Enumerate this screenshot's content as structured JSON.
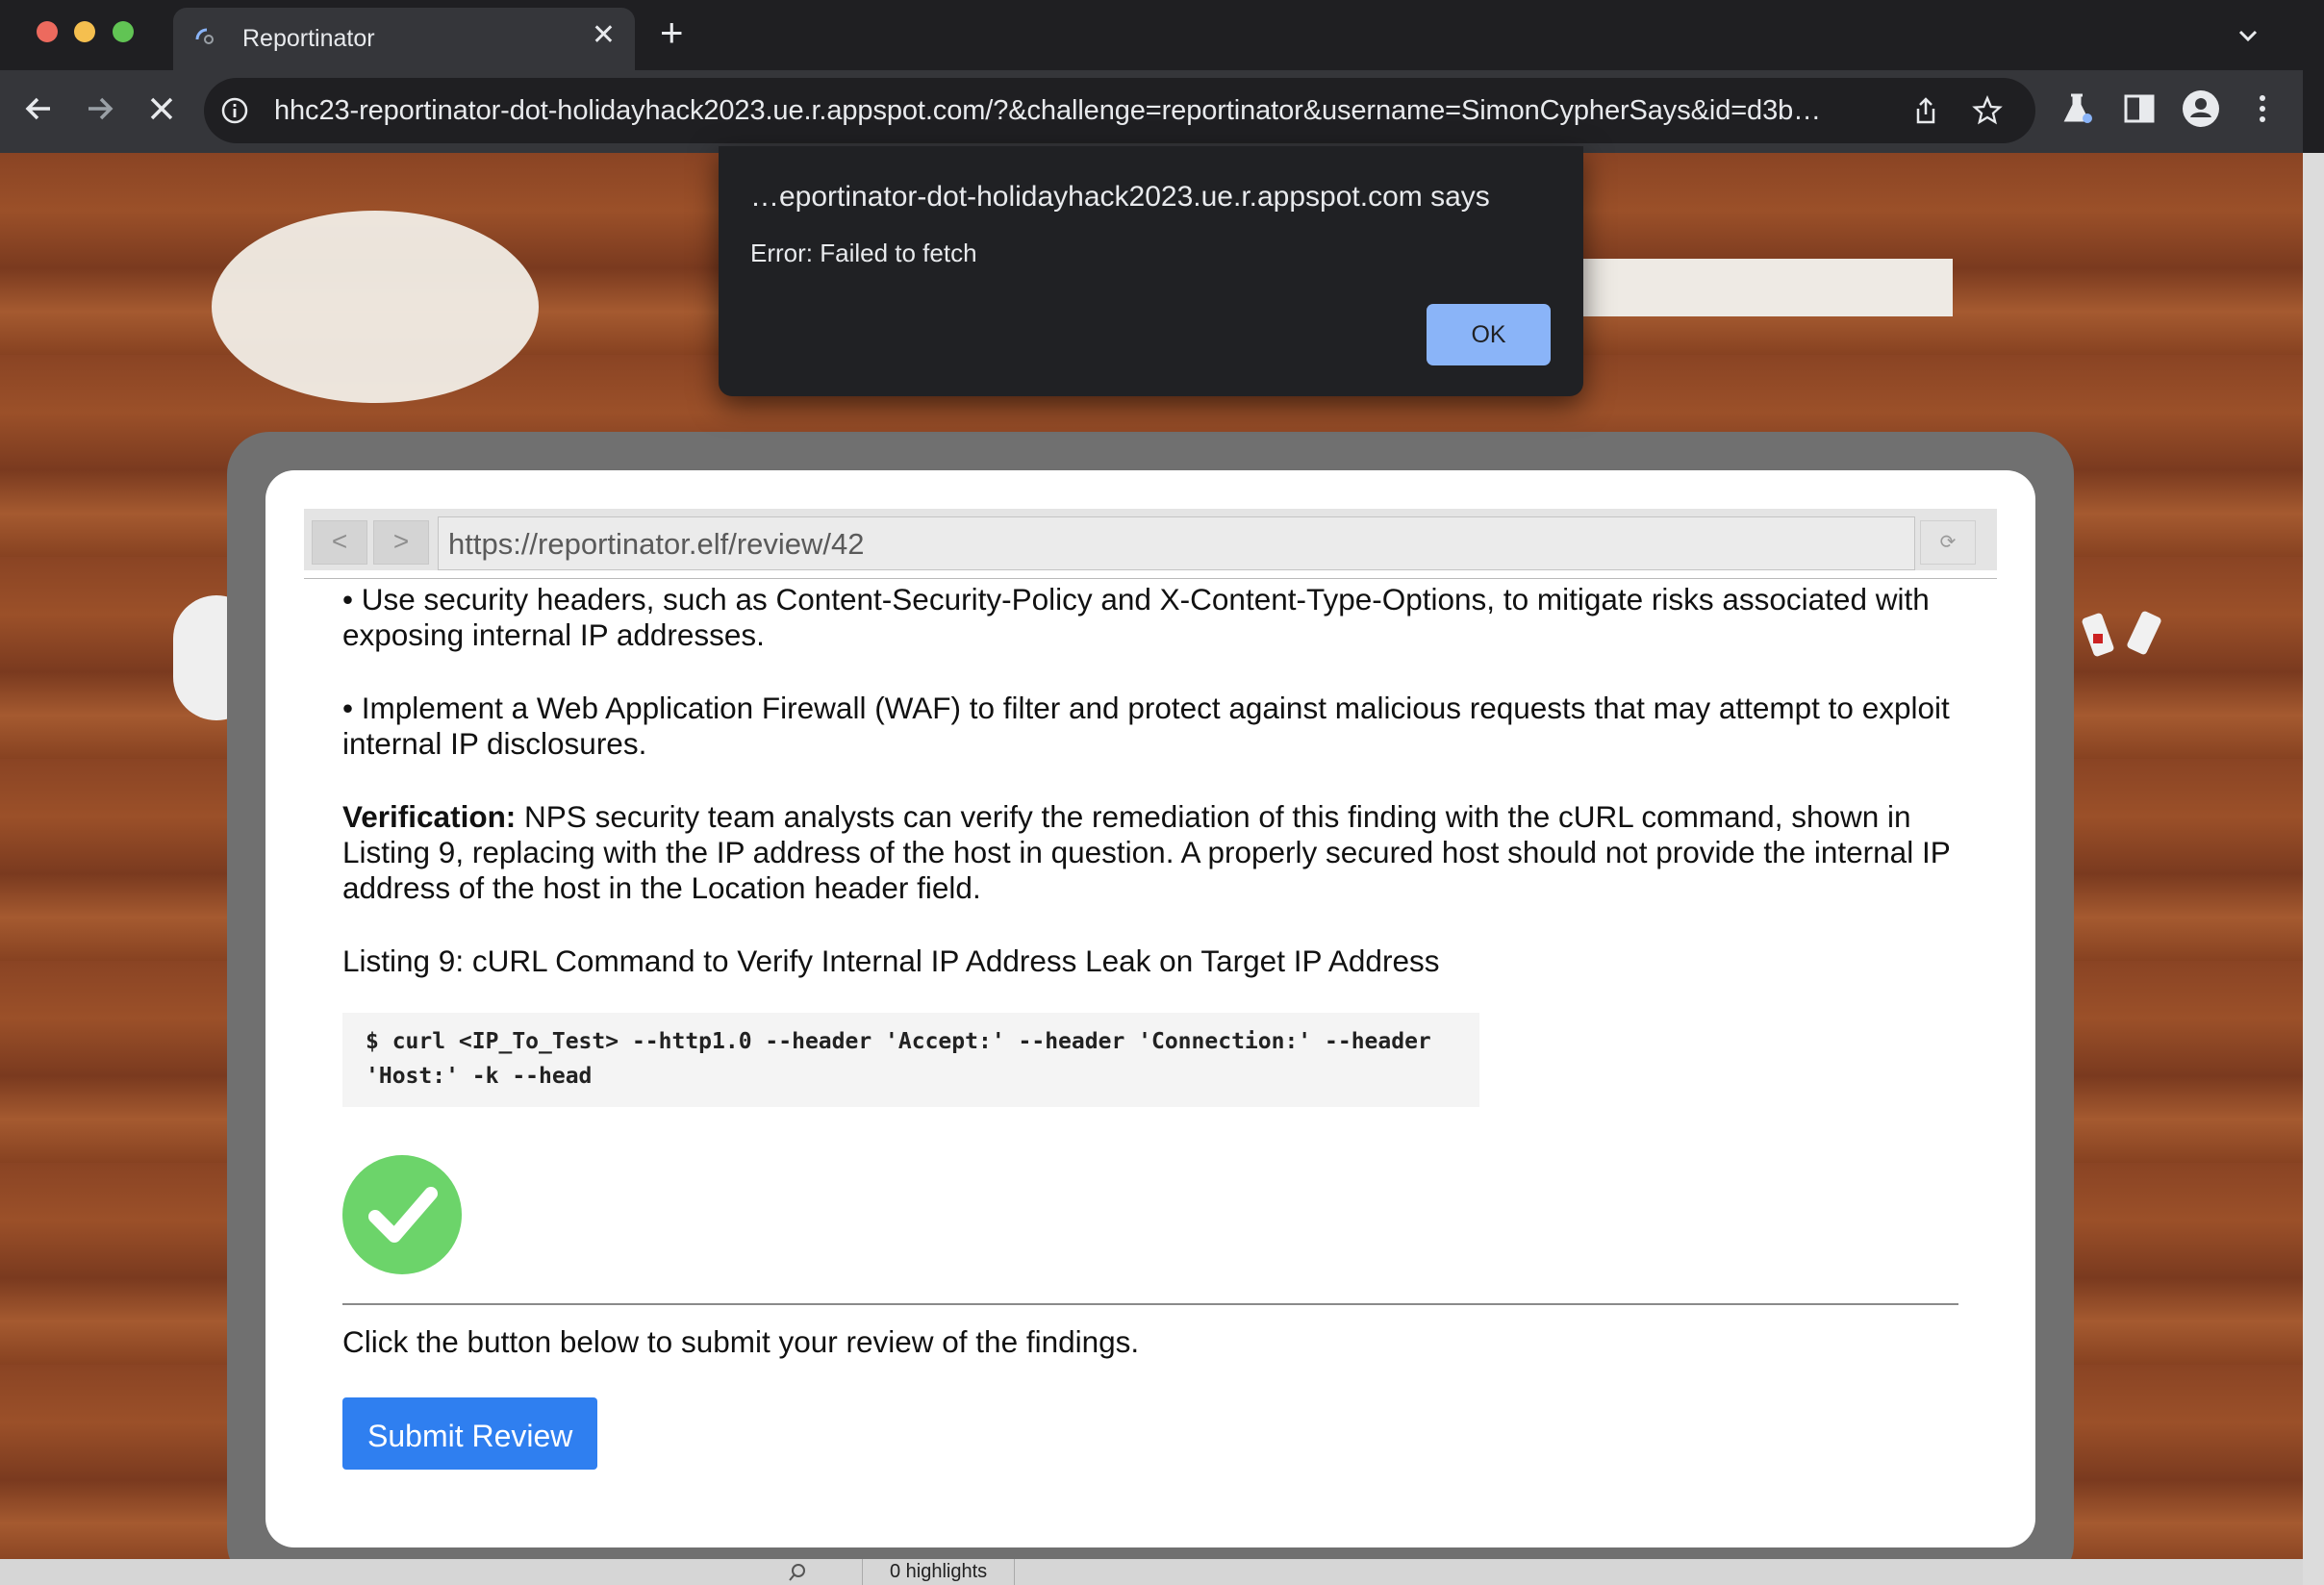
{
  "browser": {
    "tab_title": "Reportinator",
    "tab_close": "✕",
    "new_tab": "+",
    "url": "hhc23-reportinator-dot-holidayhack2023.ue.r.appspot.com/?&challenge=reportinator&username=SimonCypherSays&id=d3b…",
    "icons": [
      "back-icon",
      "forward-icon",
      "stop-icon",
      "info-icon",
      "share-icon",
      "star-icon",
      "labs-icon",
      "sidepanel-icon",
      "profile-icon",
      "menu-icon"
    ]
  },
  "dialog": {
    "title": "…eportinator-dot-holidayhack2023.ue.r.appspot.com says",
    "message": "Error: Failed to fetch",
    "ok_label": "OK"
  },
  "mock_browser": {
    "back": "<",
    "forward": ">",
    "url": "https://reportinator.elf/review/42",
    "reload": "⟳"
  },
  "report": {
    "bullet_headers": "• Use security headers, such as Content-Security-Policy and X-Content-Type-Options, to mitigate risks associated with exposing internal IP addresses.",
    "bullet_waf": "• Implement a Web Application Firewall (WAF) to filter and protect against malicious requests that may attempt to exploit internal IP disclosures.",
    "verification_label": "Verification:",
    "verification_text": " NPS security team analysts can verify the remediation of this finding with the cURL command, shown in Listing 9, replacing with the IP address of the host in question. A properly secured host should not provide the internal IP address of the host in the Location header field.",
    "listing_caption": "Listing 9: cURL Command to Verify Internal IP Address Leak on Target IP Address",
    "code_line1": "$ curl <IP_To_Test> --http1.0 --header 'Accept:' --header 'Connection:' --header",
    "code_line2": "'Host:' -k --head",
    "submit_prompt": "Click the button below to submit your review of the findings.",
    "submit_label": "Submit Review"
  },
  "status_bar": {
    "highlights": "0 highlights"
  },
  "colors": {
    "accent_button": "#2f7ff0",
    "check_green": "#6cd46a",
    "dialog_ok": "#8ab4f8"
  }
}
